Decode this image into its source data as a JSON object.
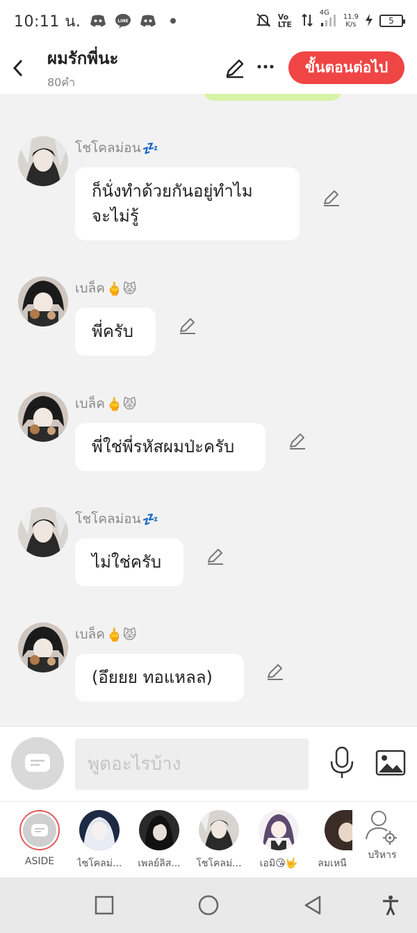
{
  "status_bar": {
    "time": "10:11 น.",
    "net_speed_value": "11.9",
    "net_speed_unit": "K/s",
    "network": "4G",
    "battery": "5",
    "volte": "Vo LTE"
  },
  "header": {
    "title": "ผมรักพี่นะ",
    "word_count": "80คำ",
    "next_button": "ขั้นตอนต่อไป"
  },
  "messages": [
    {
      "sender": "โชโคลม่อน",
      "emoji": "💤",
      "text": "ก็นั่งทำด้วยกันอยู่ทำไม\nจะไม่รู้",
      "avatar": "sleepy-dark-avatar"
    },
    {
      "sender": "เบล็ค",
      "emoji": "🖕😾",
      "text": "พี่ครับ",
      "avatar": "dark-hair-boy-avatar"
    },
    {
      "sender": "เบล็ค",
      "emoji": "🖕😾",
      "text": "พี่ใช่พี่รหัสผมป่ะครับ",
      "avatar": "dark-hair-boy-avatar"
    },
    {
      "sender": "โชโคลม่อน",
      "emoji": "💤",
      "text": "ไม่ใช่ครับ",
      "avatar": "sleepy-dark-avatar"
    },
    {
      "sender": "เบล็ค",
      "emoji": "🖕😾",
      "text": "(อึยยย ทอแหลล)",
      "avatar": "dark-hair-boy-avatar"
    }
  ],
  "input": {
    "placeholder": "พูดอะไรบ้าง"
  },
  "participants": [
    {
      "label": "ASIDE"
    },
    {
      "label": "ไซโคลม่..."
    },
    {
      "label": "เพลย์ลิส..."
    },
    {
      "label": "โชโคลม่..."
    },
    {
      "label": "เอมิ😘🤟"
    },
    {
      "label": "ลมเหนื"
    },
    {
      "label": "บริหาร"
    }
  ],
  "colors": {
    "accent": "#f04545",
    "bubble": "#ffffff",
    "background": "#f2f2f2",
    "green_bubble": "#d6f3a7"
  }
}
